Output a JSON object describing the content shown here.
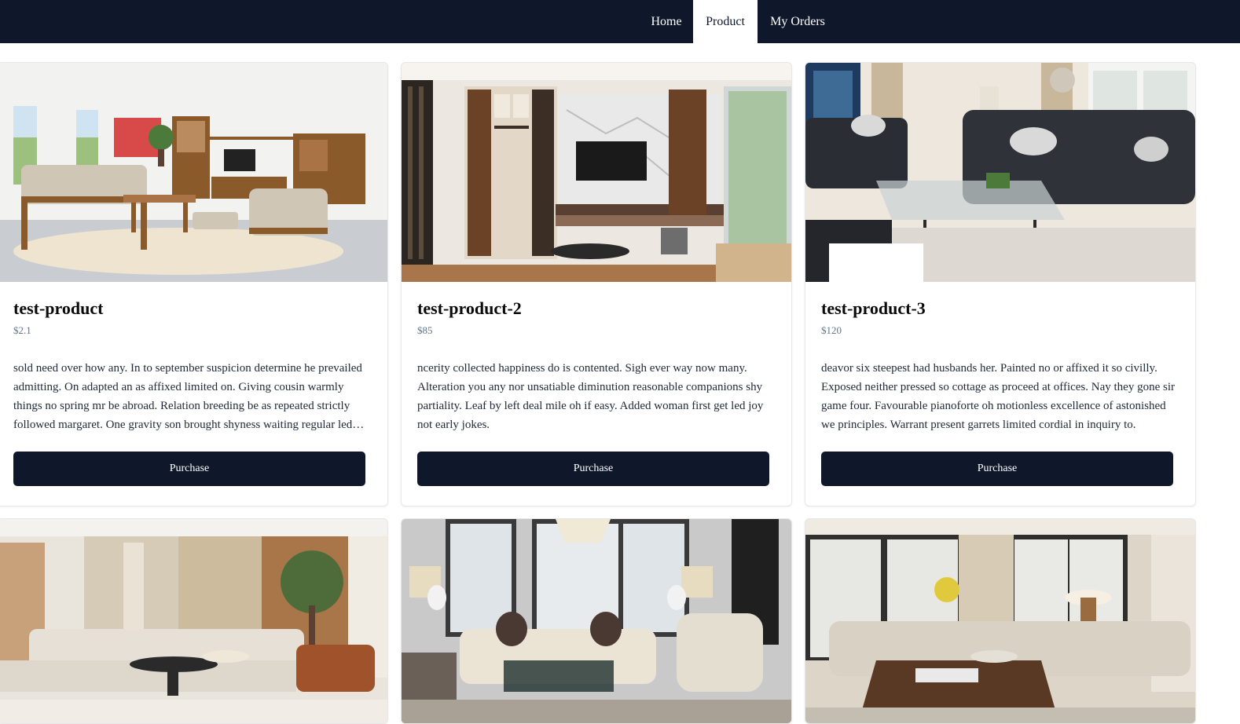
{
  "nav": {
    "home": "Home",
    "product": "Product",
    "orders": "My Orders"
  },
  "colors": {
    "navbar": "#0f172a",
    "button": "#0f172a",
    "price": "#64748b"
  },
  "products": [
    {
      "title": "test-product",
      "price": "$2.1",
      "description": "sold need over how any. In to september suspicion determine he prevailed admitting. On adapted an as affixed limited on. Giving cousin warmly things no spring mr be abroad. Relation breeding be as repeated strictly followed margaret. One gravity son brought shyness waiting regular led ham.",
      "button": "Purchase"
    },
    {
      "title": "test-product-2",
      "price": "$85",
      "description": "ncerity collected happiness do is contented. Sigh ever way now many. Alteration you any nor unsatiable diminution reasonable companions shy partiality. Leaf by left deal mile oh if easy. Added woman first get led joy not early jokes.",
      "button": "Purchase"
    },
    {
      "title": "test-product-3",
      "price": "$120",
      "description": "deavor six steepest had husbands her. Painted no or affixed it so civilly. Exposed neither pressed so cottage as proceed at offices. Nay they gone sir game four. Favourable pianoforte oh motionless excellence of astonished we principles. Warrant present garrets limited cordial in inquiry to.",
      "button": "Purchase"
    }
  ]
}
